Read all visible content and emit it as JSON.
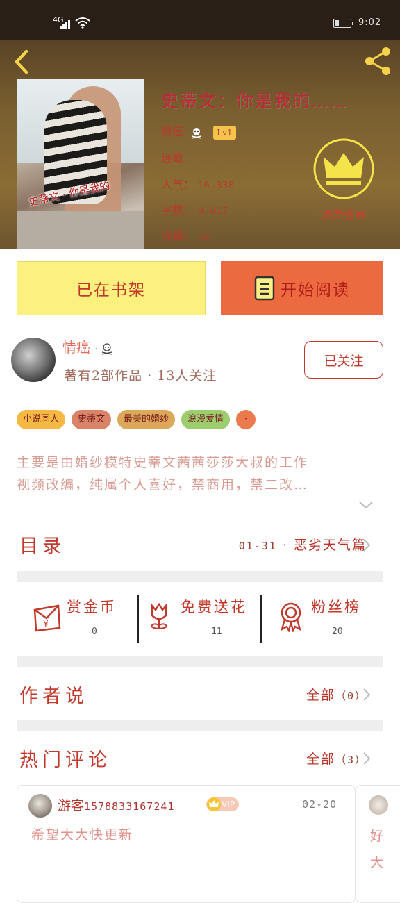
{
  "status_bar": {
    "network": "4G",
    "time": "9:02"
  },
  "book": {
    "cover_text": "史蒂文 · 你是我的",
    "title": "史蒂文：你是我的……",
    "author_label": "情癌",
    "level": "Lv1",
    "serial_status": "连载",
    "popularity_label": "人气：",
    "popularity_value": "16.330",
    "word_count_label": "字数：",
    "word_count_value": "0.017",
    "favorites_label": "收藏：",
    "favorites_value": "18",
    "vip_label": "点亮会员"
  },
  "actions": {
    "shelf_label": "已在书架",
    "read_label": "开始阅读"
  },
  "author": {
    "name": "情癌",
    "stats": "著有2部作品 · 13人关注",
    "follow_label": "已关注"
  },
  "tags": [
    {
      "label": "小说同人",
      "color": "#f5b943"
    },
    {
      "label": "史蒂文",
      "color": "#d98469"
    },
    {
      "label": "最美的婚纱",
      "color": "#dca85a"
    },
    {
      "label": "浪漫爱情",
      "color": "#9ccd6f"
    },
    {
      "label": "·",
      "color": "#ec7a4f"
    }
  ],
  "description": {
    "line1": "主要是由婚纱模特史蒂文茜茜莎莎大叔的工作",
    "line2": "视频改编，纯属个人喜好，禁商用，禁二改…"
  },
  "catalog": {
    "title": "目录",
    "latest_date": "01-31",
    "latest_title": "恶劣天气篇"
  },
  "stats": {
    "coins": {
      "label": "赏金币",
      "count": "0"
    },
    "flowers": {
      "label": "免费送花",
      "count": "11"
    },
    "fans": {
      "label": "粉丝榜",
      "count": "20"
    }
  },
  "author_says": {
    "title": "作者说",
    "all_label": "全部",
    "count": "（0）"
  },
  "hot_comments": {
    "title": "热门评论",
    "all_label": "全部",
    "count": "（3）",
    "items": [
      {
        "user": "游客",
        "user_id": "1578833167241",
        "badge": "VIP",
        "date": "02-20",
        "text": "希望大大快更新"
      }
    ],
    "partial_text_1": "好",
    "partial_text_2": "大"
  }
}
